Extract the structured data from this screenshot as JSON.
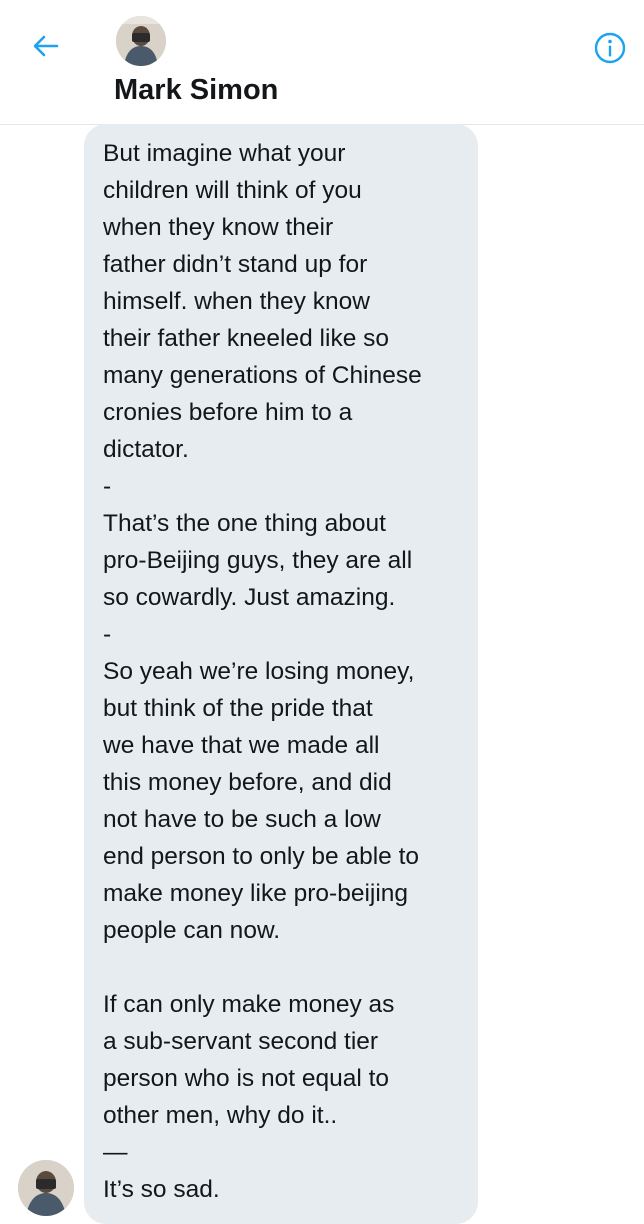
{
  "header": {
    "name": "Mark Simon",
    "back_icon": "arrow-left-icon",
    "info_icon": "info-circle-icon",
    "accent_color": "#1da1f2"
  },
  "message": {
    "lines": [
      "But imagine what your",
      "children will think of you",
      "when they know their",
      "father didn’t stand up for",
      "himself.  when they know",
      "their father kneeled like so",
      "many generations of Chinese",
      "cronies before him to a",
      "dictator.",
      "-",
      "That’s the one thing about",
      "pro-Beijing guys, they are all",
      "so cowardly.  Just amazing.",
      "-",
      "So yeah we’re losing money,",
      "but think of the pride that",
      "we have that we made all",
      "this money before, and did",
      "not have to be such a low",
      "end person to only be able to",
      "make money like pro-beijing",
      "people can now.",
      "",
      "If can only make money as",
      "a sub-servant second tier",
      "person who is not equal to",
      "other men, why do it..",
      "—",
      "It’s so sad."
    ],
    "bubble_color": "#e6ecf0"
  }
}
